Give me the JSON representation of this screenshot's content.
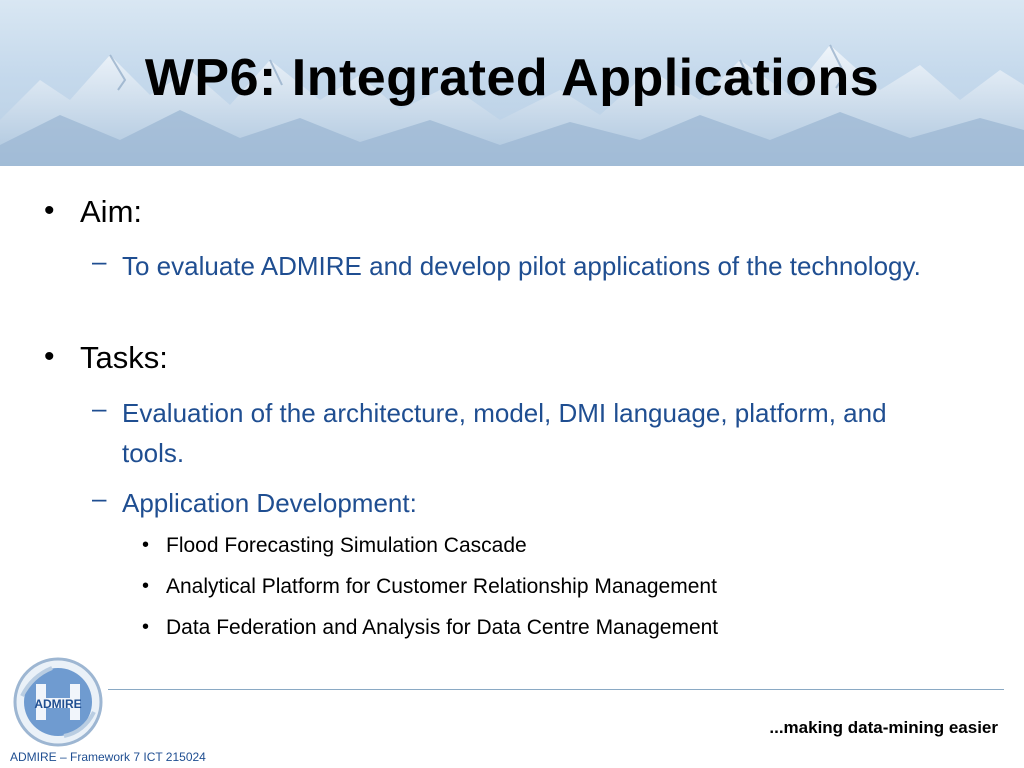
{
  "slide": {
    "title": "WP6: Integrated Applications",
    "bullets": [
      {
        "label": "Aim:",
        "sub": [
          {
            "text": "To evaluate ADMIRE and develop pilot applications of the technology."
          }
        ]
      },
      {
        "label": "Tasks:",
        "sub": [
          {
            "text": "Evaluation of the architecture, model, DMI language, platform, and tools."
          },
          {
            "text": "Application Development:",
            "items": [
              "Flood Forecasting Simulation Cascade",
              "Analytical Platform for Customer Relationship Management",
              "Data Federation and Analysis for Data Centre Management"
            ]
          }
        ]
      }
    ],
    "bullet_symbol": "•",
    "dash_symbol": "–"
  },
  "footer": {
    "logo_text": "ADMIRE",
    "tagline": "...making data-mining easier",
    "project": "ADMIRE – Framework 7 ICT 215024"
  },
  "colors": {
    "title": "#000000",
    "sub_text": "#1f4e91",
    "footer_text": "#1f4e91",
    "divider": "#8aa9c4"
  }
}
